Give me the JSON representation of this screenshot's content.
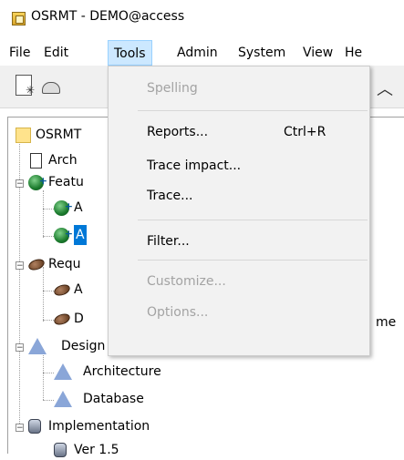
{
  "window": {
    "title": "OSRMT - DEMO@access"
  },
  "menubar": {
    "items": [
      {
        "label": "File"
      },
      {
        "label": "Edit"
      },
      {
        "label": "Tools"
      },
      {
        "label": "Admin"
      },
      {
        "label": "System"
      },
      {
        "label": "View"
      },
      {
        "label": "He"
      }
    ],
    "active": "Tools"
  },
  "tools_menu": {
    "items": [
      {
        "label": "Spelling",
        "enabled": false
      },
      {
        "label": "Reports...",
        "shortcut": "Ctrl+R",
        "enabled": true
      },
      {
        "label": "Trace impact...",
        "enabled": true
      },
      {
        "label": "Trace...",
        "enabled": true
      },
      {
        "label": "Filter...",
        "enabled": true
      },
      {
        "label": "Customize...",
        "enabled": false
      },
      {
        "label": "Options...",
        "enabled": false
      }
    ]
  },
  "tree": {
    "root": "OSRMT",
    "nodes": [
      {
        "label": "Arch",
        "icon": "document-icon"
      },
      {
        "label": "Featu",
        "icon": "globe-plus-icon"
      },
      {
        "label": "A",
        "icon": "globe-plus-icon"
      },
      {
        "label": "A",
        "icon": "globe-plus-icon",
        "selected": true
      },
      {
        "label": "Requ",
        "icon": "bean-icon"
      },
      {
        "label": "A",
        "icon": "bean-icon"
      },
      {
        "label": "D",
        "icon": "bean-icon"
      },
      {
        "label": "Design",
        "icon": "tent-icon"
      },
      {
        "label": "Architecture",
        "icon": "tent-icon"
      },
      {
        "label": "Database",
        "icon": "tent-icon"
      },
      {
        "label": "Implementation",
        "icon": "drum-icon"
      },
      {
        "label": "Ver 1.5",
        "icon": "drum-icon"
      }
    ],
    "clipped_fragment": "me"
  }
}
